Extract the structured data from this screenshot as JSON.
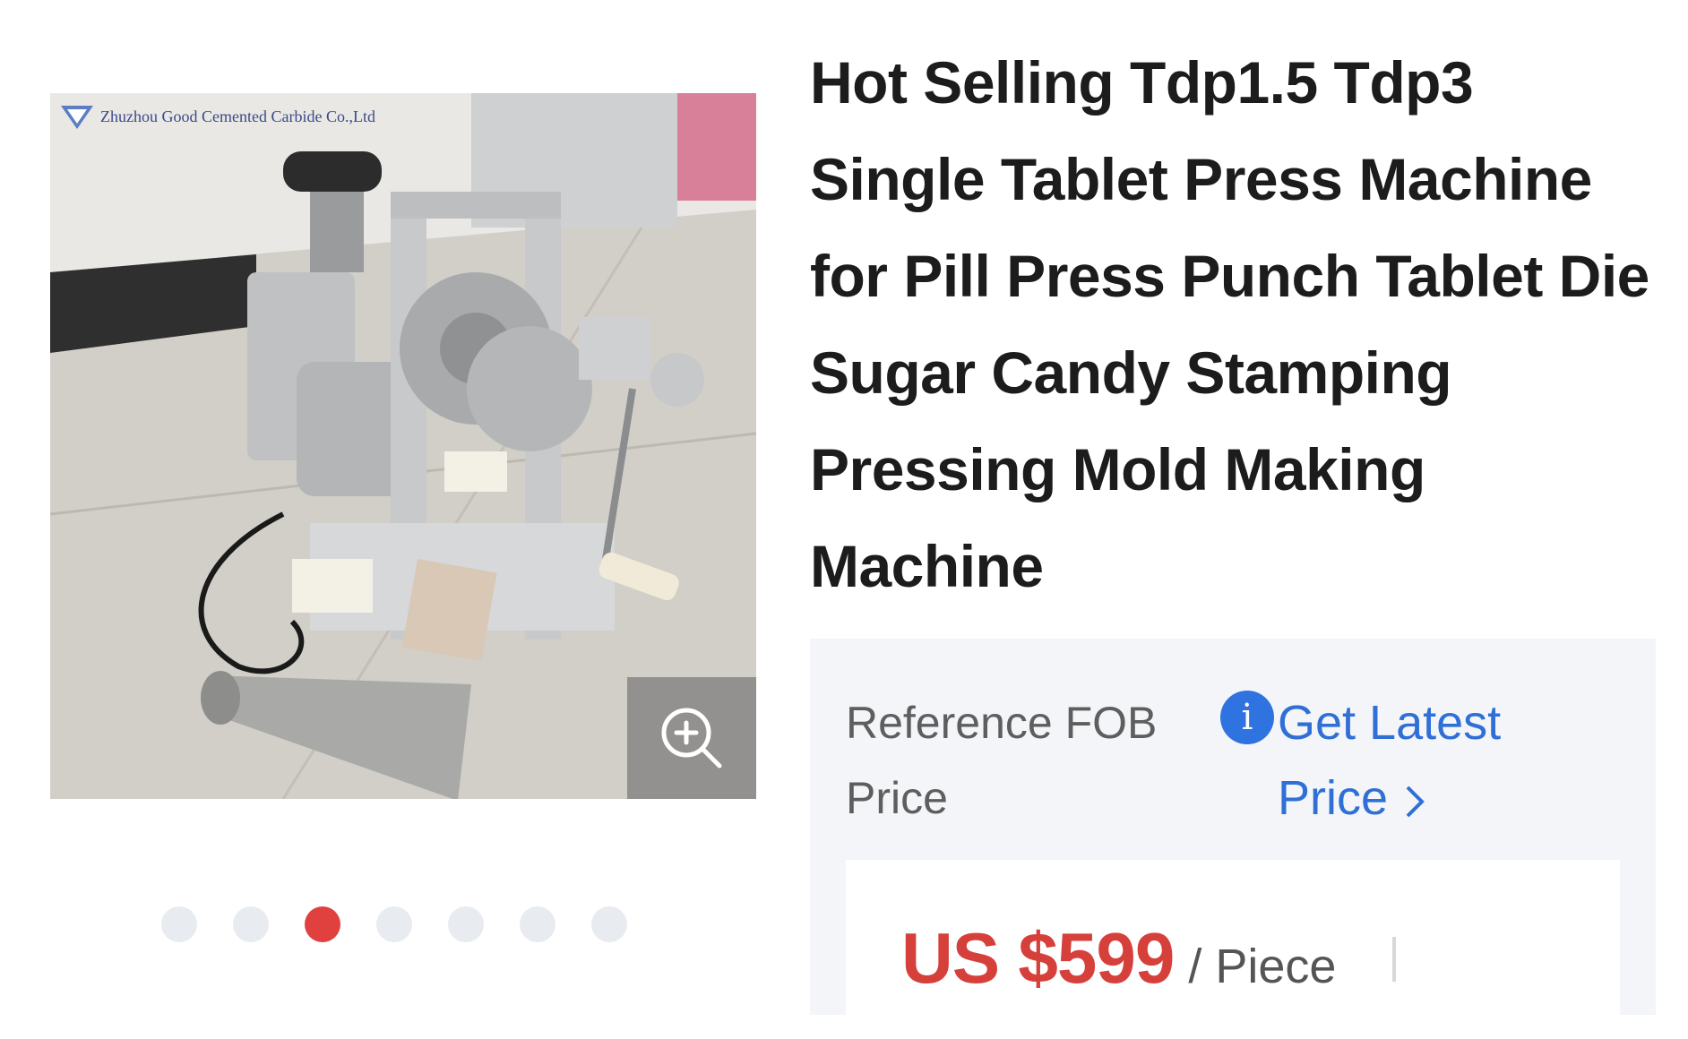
{
  "product": {
    "title": "Hot Selling Tdp1.5 Tdp3 Single Tablet Press Machine for Pill Press Punch Tablet Die Sugar Candy Stamping Pressing Mold Making Machine",
    "watermark_text": "Zhuzhou Good Cemented Carbide Co.,Ltd",
    "zoom_icon": "zoom-in-icon"
  },
  "gallery": {
    "image_count": 7,
    "active_index": 2
  },
  "price_panel": {
    "reference_label": "Reference FOB Price",
    "info_icon": "i",
    "latest_price_link": "Get Latest Price",
    "price": "US $599",
    "unit": "/ Piece"
  },
  "colors": {
    "accent_red": "#d6403b",
    "link_blue": "#2f6fd6",
    "panel_bg": "#f3f5f8"
  }
}
